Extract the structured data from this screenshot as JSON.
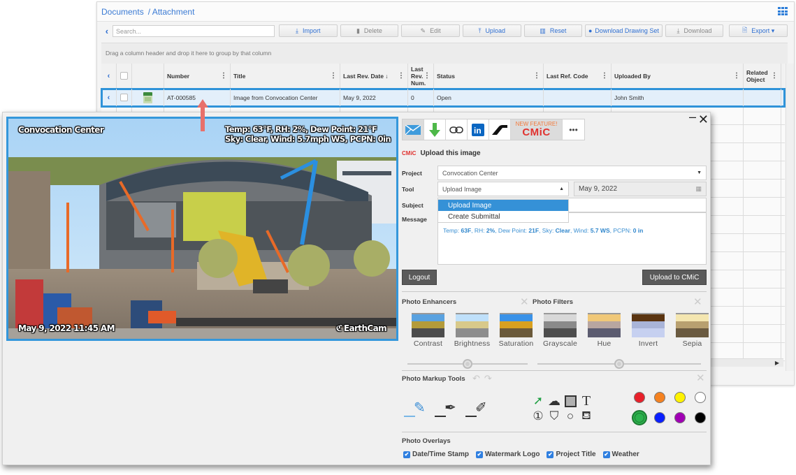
{
  "app": {
    "breadcrumb": [
      "Documents",
      "/ Attachment"
    ],
    "search_placeholder": "Search...",
    "toolbar": [
      {
        "label": "Import",
        "icon": "upload-tray-icon",
        "glyph": "⤓",
        "enabled": true
      },
      {
        "label": "Delete",
        "icon": "trash-icon",
        "glyph": "🗑",
        "enabled": false
      },
      {
        "label": "Edit",
        "icon": "edit-icon",
        "glyph": "✎",
        "enabled": false
      },
      {
        "label": "Upload",
        "icon": "upload-icon",
        "glyph": "⤒",
        "enabled": true
      },
      {
        "label": "Reset",
        "icon": "columns-icon",
        "glyph": "▥",
        "enabled": true
      },
      {
        "label": "Download Drawing Set",
        "icon": "circle-plus-icon",
        "glyph": "●",
        "enabled": true
      },
      {
        "label": "Download",
        "icon": "download-icon",
        "glyph": "⤓",
        "enabled": false
      },
      {
        "label": "Export ▾",
        "icon": "excel-icon",
        "glyph": "🗎",
        "enabled": true
      }
    ],
    "group_hint": "Drag a column header and drop it here to group by that column",
    "columns": [
      "Number",
      "Title",
      "Last Rev. Date ↓",
      "Last Rev. Num.",
      "Status",
      "Last Ref. Code",
      "Uploaded By",
      "Related Object"
    ],
    "rows": [
      {
        "number": "AT-000585",
        "title": "Image from Convocation Center",
        "last_rev_date": "May 9, 2022",
        "last_rev_num": "0",
        "status": "Open",
        "last_ref_code": "",
        "uploaded_by": "John Smith",
        "related_object": ""
      }
    ]
  },
  "photo": {
    "project_title": "Convocation Center",
    "weather_line1": "Temp: 63°F, RH: 2%, Dew Point: 21°F",
    "weather_line2": "Sky: Clear, Wind: 5.7mph WS, PCPN: 0in",
    "timestamp": "May 9, 2022 11:45 AM",
    "watermark": "EarthCam"
  },
  "share": {
    "new_feature": "NEW FEATURE!",
    "cmic_logo": "CMiC",
    "more": "•••"
  },
  "upload_form": {
    "heading_logo": "CMiC",
    "heading": "Upload this image",
    "labels": {
      "project": "Project",
      "tool": "Tool",
      "subject": "Subject",
      "message": "Message"
    },
    "project_value": "Convocation Center",
    "tool_value": "Upload Image",
    "date_value": "May 9, 2022",
    "tool_options": [
      "Upload Image",
      "Create Submittal"
    ],
    "tool_selected": "Upload Image",
    "message": {
      "temp_label": "Temp: ",
      "temp": "63F",
      "rh_label": ", RH: ",
      "rh": "2%",
      "dew_label": ", Dew Point: ",
      "dew": "21F",
      "sky_label": ", Sky: ",
      "sky": "Clear",
      "wind_label": ", Wind: ",
      "wind": "5.7 WS",
      "pcpn_label": ", PCPN: ",
      "pcpn": "0 in"
    },
    "logout_label": "Logout",
    "upload_label": "Upload to CMiC"
  },
  "enhancers": {
    "title": "Photo Enhancers",
    "items": [
      "Contrast",
      "Brightness",
      "Saturation"
    ],
    "slider_value": 0.5
  },
  "filters": {
    "title": "Photo Filters",
    "items": [
      "Grayscale",
      "Hue",
      "Invert",
      "Sepia"
    ],
    "slider_value": 0.5
  },
  "markup": {
    "title": "Photo Markup Tools",
    "pens": [
      {
        "name": "pencil",
        "active": true
      },
      {
        "name": "pen",
        "active": false
      },
      {
        "name": "highlighter",
        "active": false
      }
    ],
    "shapes": [
      "arrow",
      "cloud",
      "rectangle",
      "text",
      "numbered-marker",
      "polygon",
      "circle",
      "fill-bucket"
    ],
    "colors": [
      {
        "name": "red",
        "hex": "#e8202a",
        "selected": false
      },
      {
        "name": "orange",
        "hex": "#f58220",
        "selected": false
      },
      {
        "name": "yellow",
        "hex": "#fff200",
        "selected": false
      },
      {
        "name": "white",
        "hex": "#ffffff",
        "selected": false
      },
      {
        "name": "green",
        "hex": "#2bb24c",
        "selected": true
      },
      {
        "name": "blue",
        "hex": "#0a1fff",
        "selected": false
      },
      {
        "name": "purple",
        "hex": "#a000b4",
        "selected": false
      },
      {
        "name": "black",
        "hex": "#000000",
        "selected": false
      }
    ]
  },
  "overlays": {
    "title": "Photo Overlays",
    "items": [
      {
        "label": "Date/Time Stamp",
        "checked": true
      },
      {
        "label": "Watermark Logo",
        "checked": true
      },
      {
        "label": "Project Title",
        "checked": true
      },
      {
        "label": "Weather",
        "checked": true
      }
    ]
  }
}
